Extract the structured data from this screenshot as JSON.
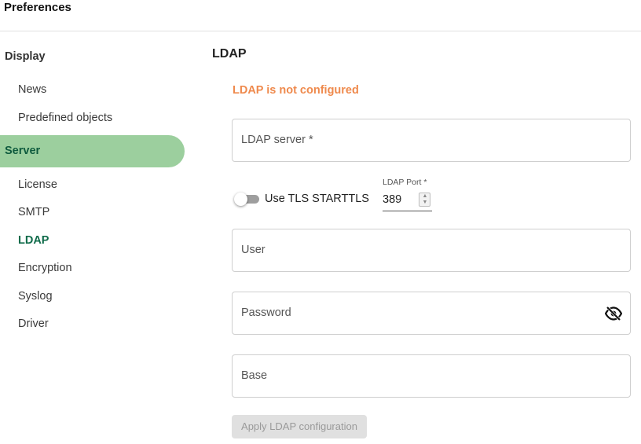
{
  "app": {
    "title": "Preferences"
  },
  "sidebar": {
    "display_section": "Display",
    "display_items": [
      {
        "label": "News"
      },
      {
        "label": "Predefined objects"
      }
    ],
    "server_section": "Server",
    "server_items": [
      {
        "label": "License",
        "active": false
      },
      {
        "label": "SMTP",
        "active": false
      },
      {
        "label": "LDAP",
        "active": true
      },
      {
        "label": "Encryption",
        "active": false
      },
      {
        "label": "Syslog",
        "active": false
      },
      {
        "label": "Driver",
        "active": false
      }
    ]
  },
  "main": {
    "title": "LDAP",
    "status": "LDAP is not configured",
    "status_color": "#ef8a4d",
    "fields": {
      "server": {
        "placeholder": "LDAP server *",
        "value": ""
      },
      "user": {
        "placeholder": "User",
        "value": ""
      },
      "password": {
        "placeholder": "Password",
        "value": "",
        "icon": "eye-off-icon"
      },
      "base": {
        "placeholder": "Base",
        "value": ""
      }
    },
    "tls_toggle": {
      "label": "Use TLS STARTTLS",
      "checked": false
    },
    "port": {
      "label": "LDAP Port *",
      "value": "389"
    },
    "apply_button": {
      "label": "Apply LDAP configuration",
      "enabled": false
    }
  },
  "colors": {
    "accent_green": "#9ccf9e",
    "active_text": "#0f6b4a"
  }
}
